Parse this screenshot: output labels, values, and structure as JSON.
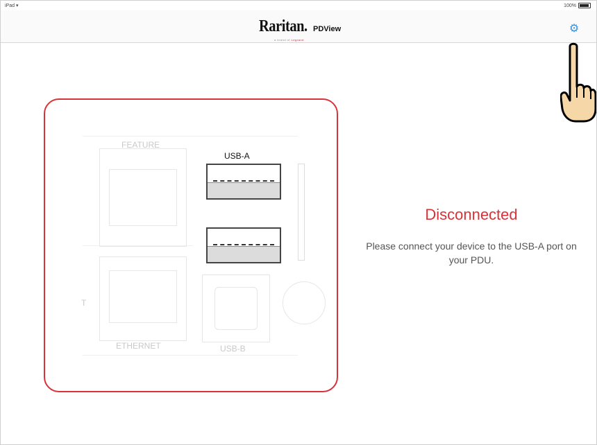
{
  "statusbar": {
    "left": "iPad",
    "battery_text": "100%"
  },
  "navbar": {
    "brand_logo": "Raritan.",
    "app_name": "PDView",
    "brand_tagline_prefix": "a brand of",
    "brand_tagline_name": "Legrand",
    "settings_icon": "gear-icon"
  },
  "device_panel": {
    "feature_label": "FEATURE",
    "usb_a_label": "USB-A",
    "ethernet_label": "ETHERNET",
    "usb_b_label": "USB-B",
    "side_label": "T"
  },
  "status": {
    "title": "Disconnected",
    "message": "Please connect your device to the USB-A port on your PDU."
  },
  "colors": {
    "accent_red": "#d7323a",
    "link_blue": "#3a8fd8"
  }
}
